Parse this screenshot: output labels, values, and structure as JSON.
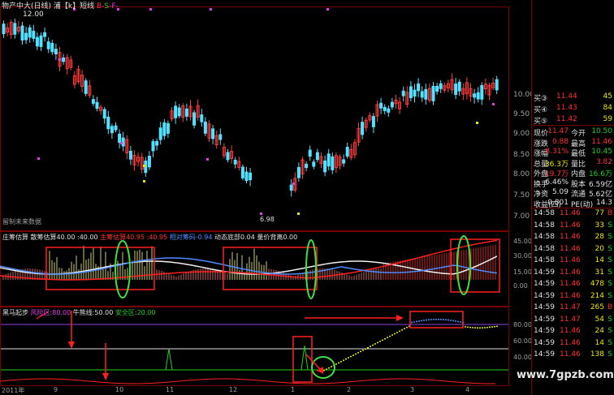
{
  "header": {
    "title": "物产中大(日线) 浦【k】短线",
    "flags": [
      "B",
      "-",
      "S",
      "-",
      "F",
      "-"
    ],
    "price_high_label": "12.00",
    "note": "留制未来数据",
    "low_label": "6.98"
  },
  "axis_main": [
    "10.00",
    "9.50",
    "9.00",
    "8.50",
    "8.00",
    "7.50",
    "7.00"
  ],
  "indicator1": {
    "title": "庄筹估算",
    "items": [
      {
        "label": "散筹估算",
        "value": "40.00",
        "color": "#e0e0e0"
      },
      {
        "label": "",
        "value": "40.00",
        "color": "#e0e0e0"
      },
      {
        "label": "主筹估算",
        "value": "40.95",
        "color": "#ff3232"
      },
      {
        "label": "",
        "value": "40.95",
        "color": "#ff3232"
      },
      {
        "label": "相对筹码",
        "value": "-0.94",
        "color": "#4f8cff"
      },
      {
        "label": "动态底部",
        "value": "0.04",
        "color": "#e0e0e0"
      },
      {
        "label": "量价背离",
        "value": "0.00",
        "color": "#e0e0e0"
      }
    ],
    "axis": [
      "45.00",
      "30.00",
      "15.00",
      "0.00"
    ]
  },
  "indicator2": {
    "title": "黑马起步",
    "items": [
      {
        "label": "风险区",
        "value": "80.00",
        "color": "#e040e0"
      },
      {
        "label": "牛熊线",
        "value": "50.00",
        "color": "#e0e0e0"
      },
      {
        "label": "安全区",
        "value": "20.00",
        "color": "#20d020"
      }
    ],
    "axis": [
      "80.00",
      "60.00",
      "40.00"
    ]
  },
  "time_axis": [
    "2011年",
    "9",
    "10",
    "11",
    "12",
    "1",
    "2",
    "3",
    "4"
  ],
  "watermark": "www.7gpzb.com",
  "order_book": [
    {
      "label": "买③",
      "price": "11.44",
      "vol": "45"
    },
    {
      "label": "买④",
      "price": "11.43",
      "vol": "84"
    },
    {
      "label": "买⑤",
      "price": "11.42",
      "vol": "59"
    }
  ],
  "quote": [
    {
      "l1": "现价",
      "v1": "11.47",
      "c1": "red",
      "l2": "今开",
      "v2": "10.50",
      "c2": "green"
    },
    {
      "l1": "涨跌",
      "v1": "0.88",
      "c1": "red",
      "l2": "最高",
      "v2": "11.46",
      "c2": "red"
    },
    {
      "l1": "涨幅",
      "v1": "8.31%",
      "c1": "red",
      "l2": "最低",
      "v2": "10.45",
      "c2": "green"
    },
    {
      "l1": "总量",
      "v1": "36.3万",
      "c1": "yellow",
      "l2": "量比",
      "v2": "3.82",
      "c2": "red"
    },
    {
      "l1": "外盘",
      "v1": "19.7万",
      "c1": "red",
      "l2": "内盘",
      "v2": "16.6万",
      "c2": "green"
    },
    {
      "l1": "换手",
      "v1": "6.46%",
      "c1": "white",
      "l2": "股本",
      "v2": "6.59亿",
      "c2": "white"
    },
    {
      "l1": "净资",
      "v1": "5.09",
      "c1": "white",
      "l2": "流通",
      "v2": "5.62亿",
      "c2": "white"
    },
    {
      "l1": "收益(四)",
      "v1": "0.801",
      "c1": "white",
      "l2": "PE(动)",
      "v2": "14.3",
      "c2": "white"
    }
  ],
  "trades": [
    {
      "time": "14:58",
      "price": "11.46",
      "vol": "77",
      "side": "B"
    },
    {
      "time": "14:58",
      "price": "11.46",
      "vol": "33",
      "side": "S"
    },
    {
      "time": "14:58",
      "price": "11.46",
      "vol": "28",
      "side": "S"
    },
    {
      "time": "14:58",
      "price": "11.46",
      "vol": "20",
      "side": "S"
    },
    {
      "time": "14:58",
      "price": "11.46",
      "vol": "14",
      "side": "S"
    },
    {
      "time": "14:59",
      "price": "11.46",
      "vol": "31",
      "side": "S"
    },
    {
      "time": "14:59",
      "price": "11.46",
      "vol": "478",
      "side": "S"
    },
    {
      "time": "14:59",
      "price": "11.46",
      "vol": "214",
      "side": "S"
    },
    {
      "time": "14:59",
      "price": "11.47",
      "vol": "265",
      "side": "B"
    },
    {
      "time": "14:59",
      "price": "11.47",
      "vol": "54",
      "side": "S"
    },
    {
      "time": "14:59",
      "price": "11.46",
      "vol": "24",
      "side": "S"
    },
    {
      "time": "14:59",
      "price": "11.46",
      "vol": "14",
      "side": "S"
    },
    {
      "time": "14:59",
      "price": "11.46",
      "vol": "138",
      "side": "S"
    }
  ]
}
